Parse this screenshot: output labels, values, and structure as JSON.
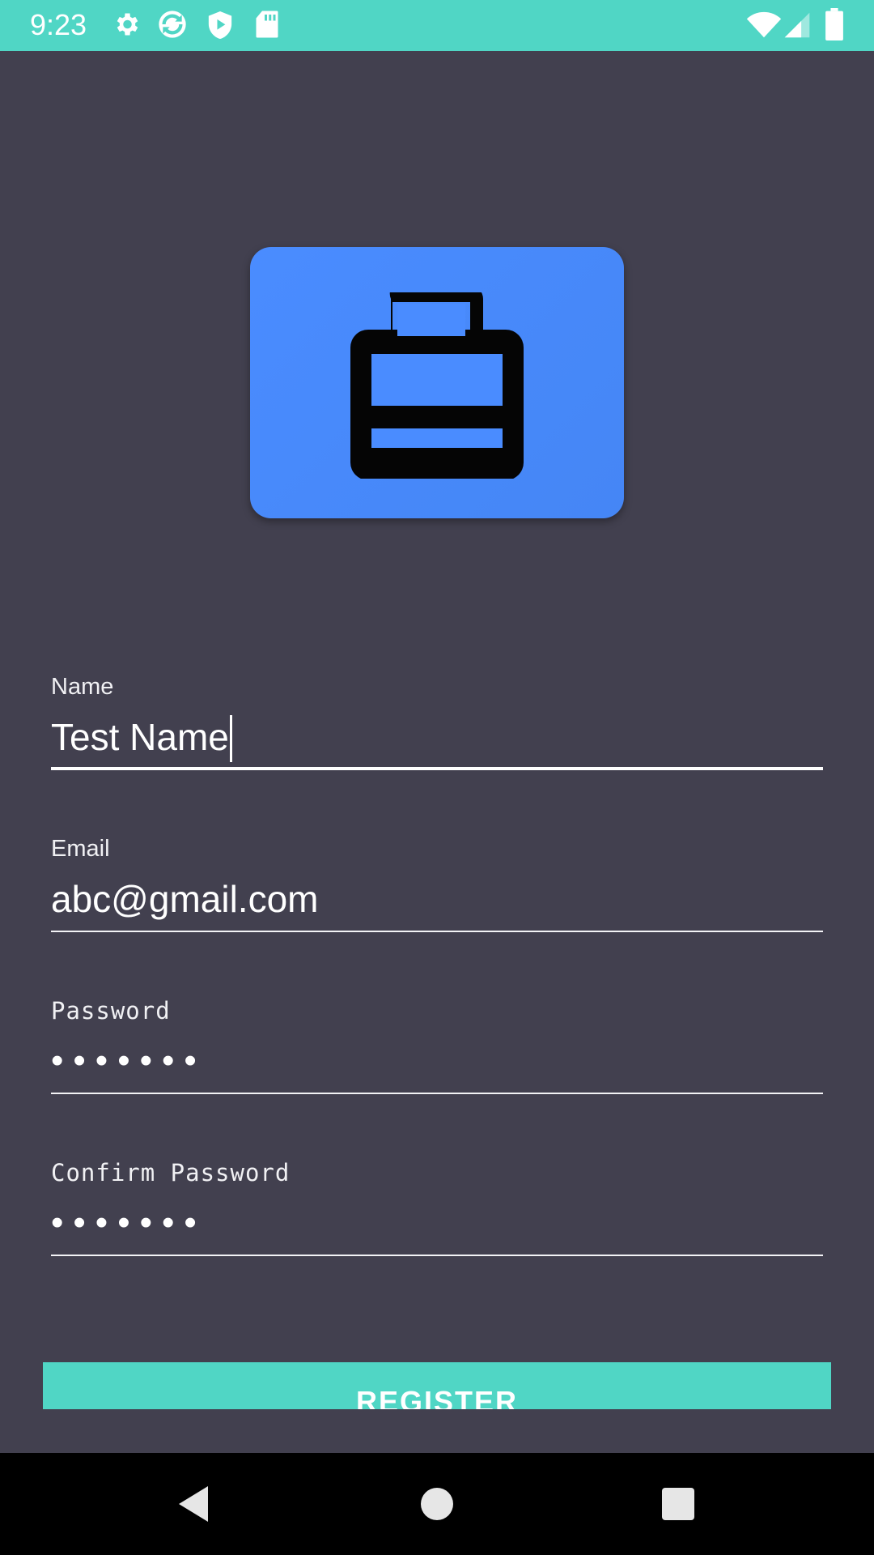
{
  "status_bar": {
    "time": "9:23",
    "left_icons": [
      "gear-icon",
      "sync-icon",
      "shield-play-icon",
      "sd-card-icon"
    ],
    "right_icons": [
      "wifi-icon",
      "signal-icon",
      "battery-icon"
    ],
    "color": "#50d6c5"
  },
  "logo": {
    "icon": "briefcase-icon",
    "color": "#4a8cff"
  },
  "form": {
    "name": {
      "label": "Name",
      "value": "Test Name"
    },
    "email": {
      "label": "Email",
      "value": "abc@gmail.com"
    },
    "password": {
      "label": "Password",
      "value": "•••••••"
    },
    "confirm_password": {
      "label": "Confirm Password",
      "value": "•••••••"
    }
  },
  "register_button": {
    "label": "REGISTER",
    "color": "#50d6c5"
  },
  "nav_bar": {
    "items": [
      "back-icon",
      "home-icon",
      "recents-icon"
    ]
  },
  "theme": {
    "background": "#42404f"
  }
}
